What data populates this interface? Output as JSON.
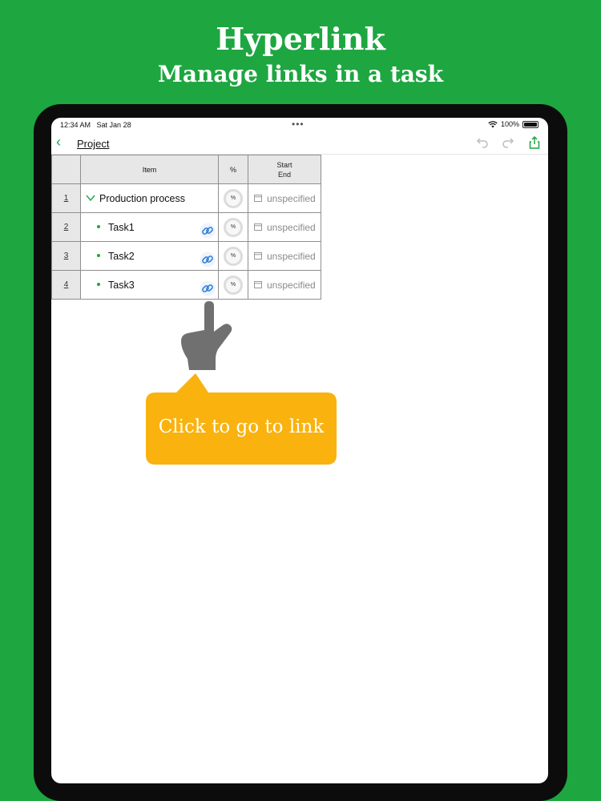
{
  "banner": {
    "title": "Hyperlink",
    "subtitle": "Manage links in a task"
  },
  "status_bar": {
    "time": "12:34 AM",
    "date": "Sat Jan 28",
    "battery": "100%"
  },
  "nav": {
    "back_icon": "chevron-left-icon",
    "title": "Project",
    "actions": [
      "undo-icon",
      "redo-icon",
      "share-icon"
    ]
  },
  "grid": {
    "headers": {
      "item": "Item",
      "percent": "%",
      "start": "Start",
      "end": "End"
    },
    "rows": [
      {
        "num": "1",
        "item": "Production process",
        "pct": "%",
        "start": "unspecified",
        "type": "group"
      },
      {
        "num": "2",
        "item": "Task1",
        "pct": "%",
        "start": "unspecified",
        "type": "task",
        "has_link": true
      },
      {
        "num": "3",
        "item": "Task2",
        "pct": "%",
        "start": "unspecified",
        "type": "task",
        "has_link": true
      },
      {
        "num": "4",
        "item": "Task3",
        "pct": "%",
        "start": "unspecified",
        "type": "task",
        "has_link": true
      }
    ]
  },
  "callout": {
    "text": "Click to go to link"
  },
  "colors": {
    "brand_green": "#1ea641",
    "callout_yellow": "#fab20e",
    "link_blue": "#2f7fd8"
  }
}
